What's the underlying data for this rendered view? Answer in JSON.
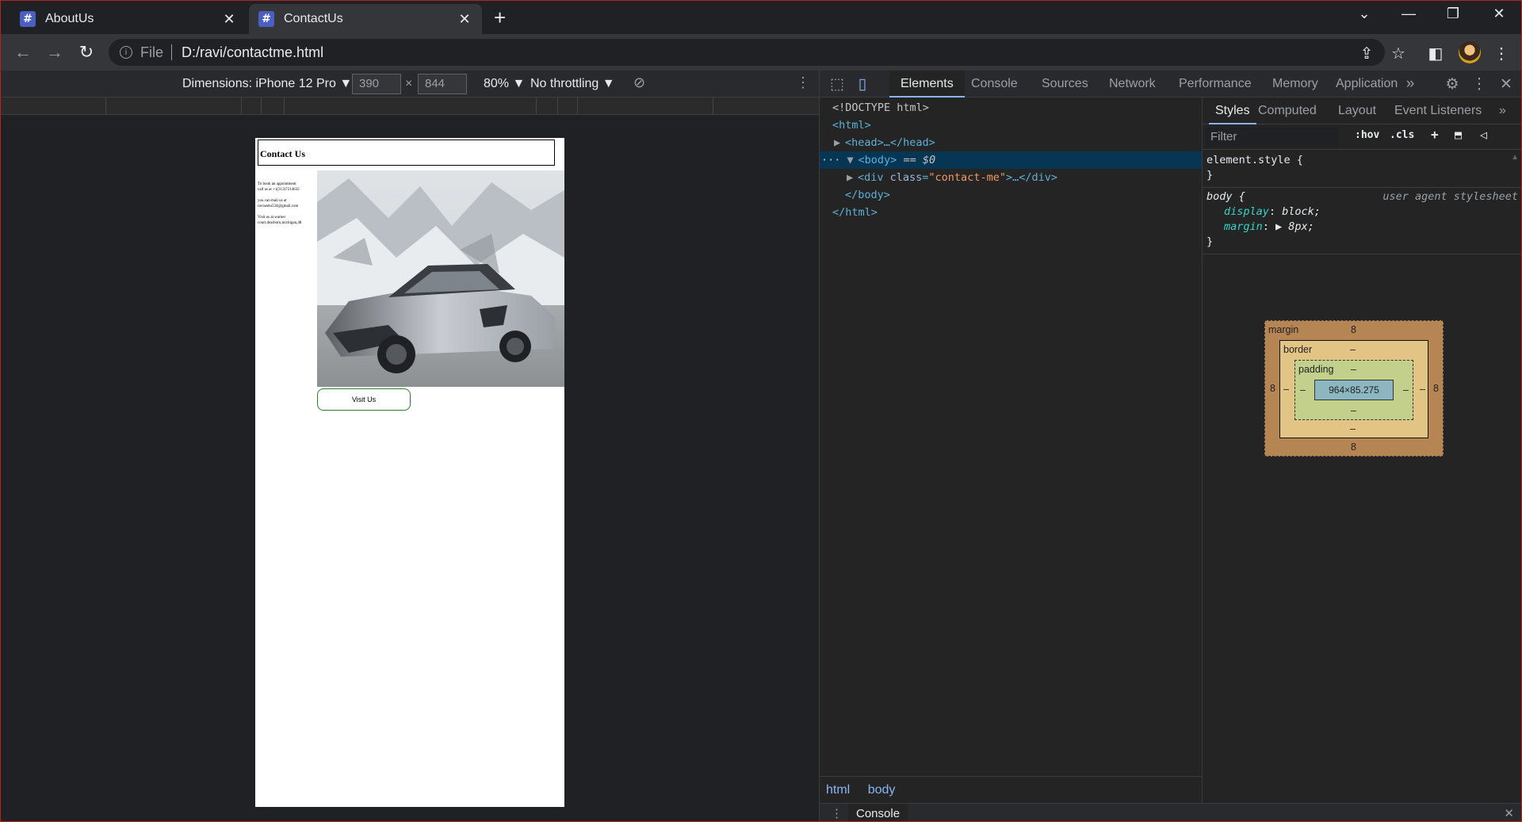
{
  "tabs": [
    {
      "title": "AboutUs",
      "favicon": "#"
    },
    {
      "title": "ContactUs",
      "favicon": "#"
    }
  ],
  "new_tab_glyph": "+",
  "window_controls": {
    "tab_search": "⌄",
    "minimize": "—",
    "restore": "❐",
    "close": "✕"
  },
  "toolbar": {
    "back": "←",
    "forward": "→",
    "reload": "↻",
    "info_glyph": "i",
    "scheme_label": "File",
    "url": "D:/ravi/contactme.html",
    "share": "⇪",
    "star": "☆",
    "sidepanel": "◧",
    "menu": "⋮"
  },
  "device_toolbar": {
    "dimensions": "Dimensions: iPhone 12 Pro ▼",
    "width": "390",
    "times": "×",
    "height": "844",
    "zoom": "80% ▼",
    "throttling": "No throttling ▼",
    "rotate": "⊘",
    "more": "⋮"
  },
  "page": {
    "header": "Contact Us",
    "lines": [
      "To book an appointment",
      "call us at +1(313)7214632",
      "",
      "you can mail us at",
      "raviseelu534@gmail.com",
      "",
      "Visit us at warner",
      "court,dearborn,michigan,48"
    ],
    "button": "Visit Us"
  },
  "devtools": {
    "tabs": [
      "Elements",
      "Console",
      "Sources",
      "Network",
      "Performance",
      "Memory",
      "Application"
    ],
    "overflow": "»",
    "settings": "⚙",
    "more": "⋮",
    "close": "✕",
    "dom": {
      "doctype": "<!DOCTYPE html>",
      "html_open": "<html>",
      "head": "<head>…</head>",
      "body_open": "<body>",
      "body_marker": "== $0",
      "dots": "···",
      "div_open": "<div ",
      "div_attr_name": "class",
      "div_attr_value": "\"contact-me\"",
      "div_close": ">…</div>",
      "body_close": "</body>",
      "html_close": "</html>"
    },
    "breadcrumb": [
      "html",
      "body"
    ],
    "styles_tabs": [
      "Styles",
      "Computed",
      "Layout",
      "Event Listeners"
    ],
    "styles_overflow": "»",
    "filter_placeholder": "Filter",
    "filter_hov": ":hov",
    "filter_cls": ".cls",
    "filter_plus": "+",
    "element_style": "element.style {",
    "close_brace": "}",
    "body_rule": {
      "selector": "body {",
      "source": "user agent stylesheet",
      "props": [
        {
          "name": "display",
          "value": "block;"
        },
        {
          "name": "margin",
          "value": "▶ 8px;"
        }
      ]
    },
    "box_model": {
      "margin_label": "margin",
      "border_label": "border",
      "padding_label": "padding",
      "margin": "8",
      "dash": "–",
      "content": "964×85.275"
    },
    "console_label": "Console",
    "drawer_dots": "⋮",
    "drawer_close": "✕"
  },
  "colors": {
    "selected_row": "#073655",
    "button_border": "#2e7d32",
    "accent": "#8ab4f8"
  }
}
